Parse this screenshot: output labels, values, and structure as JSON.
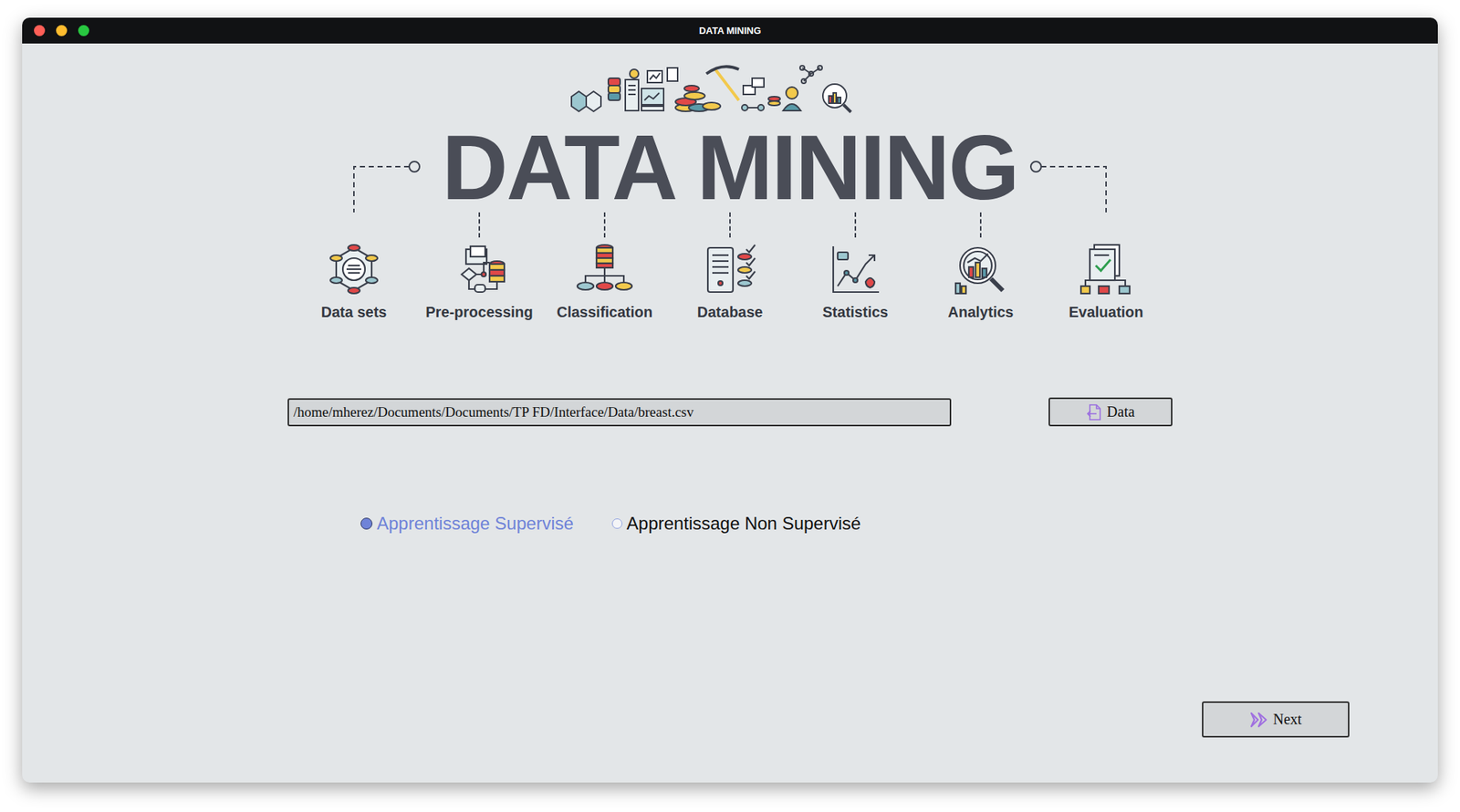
{
  "window": {
    "title": "DATA MINING"
  },
  "banner": {
    "title": "DATA MINING",
    "steps": [
      {
        "label": "Data sets"
      },
      {
        "label": "Pre-processing"
      },
      {
        "label": "Classification"
      },
      {
        "label": "Database"
      },
      {
        "label": "Statistics"
      },
      {
        "label": "Analytics"
      },
      {
        "label": "Evaluation"
      }
    ]
  },
  "file_field": {
    "value": "/home/mherez/Documents/Documents/TP FD/Interface/Data/breast.csv"
  },
  "data_button": {
    "label": "Data"
  },
  "learning_modes": [
    {
      "label": "Apprentissage Supervisé",
      "selected": true
    },
    {
      "label": "Apprentissage Non Supervisé",
      "selected": false
    }
  ],
  "next_button": {
    "label": "Next"
  }
}
